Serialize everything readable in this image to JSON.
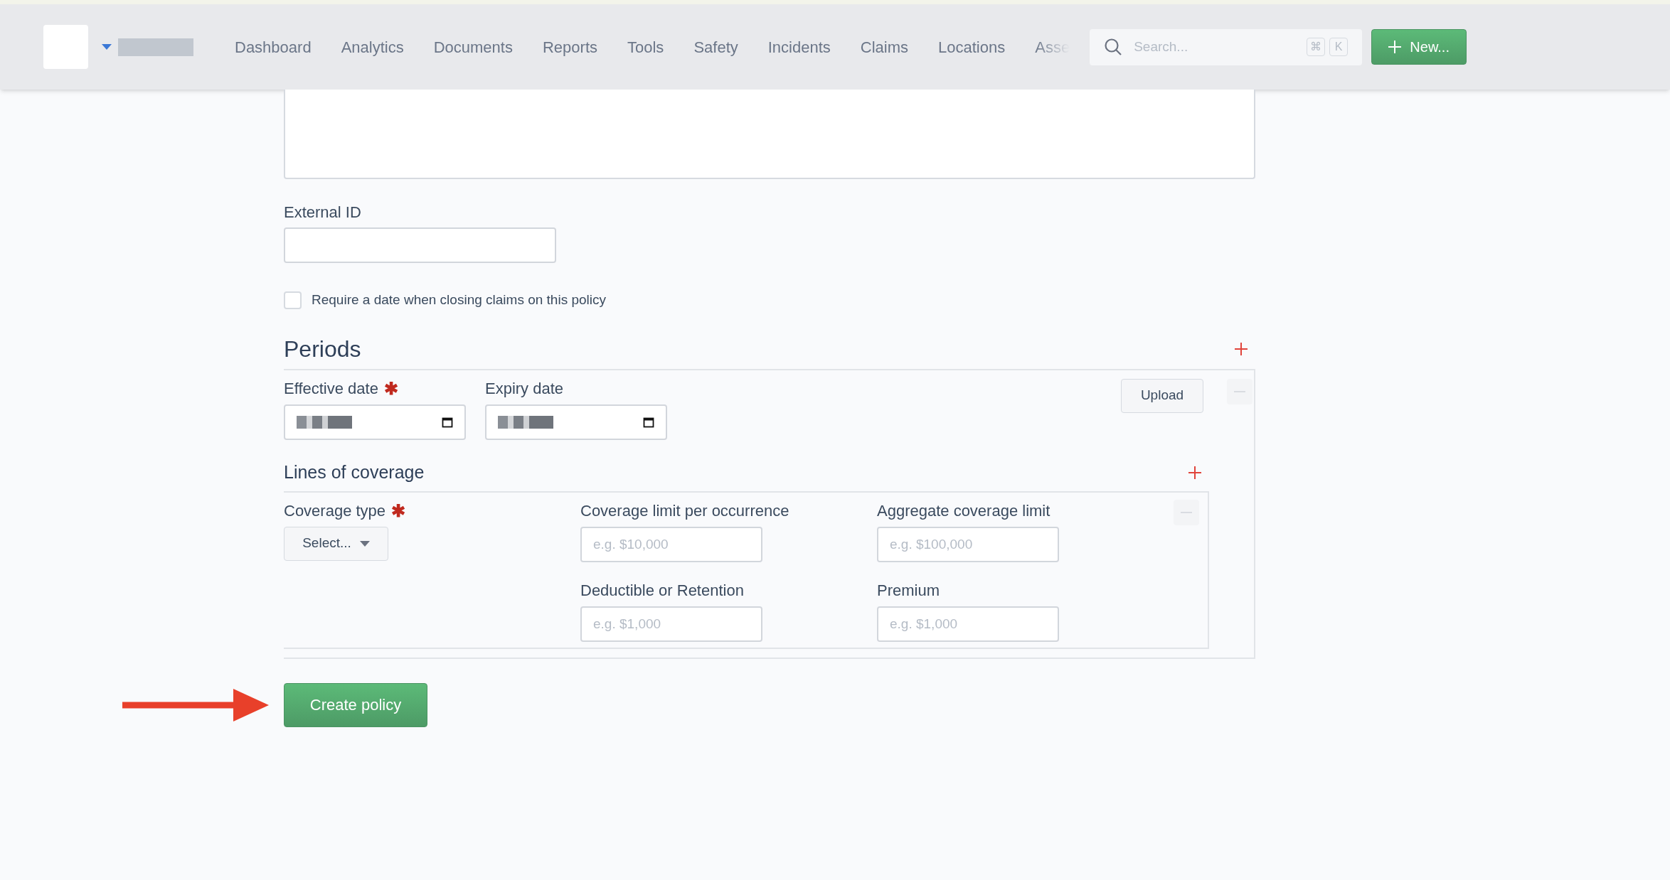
{
  "nav": {
    "items": [
      {
        "label": "Dashboard",
        "faded": false
      },
      {
        "label": "Analytics",
        "faded": false
      },
      {
        "label": "Documents",
        "faded": false
      },
      {
        "label": "Reports",
        "faded": false
      },
      {
        "label": "Tools",
        "faded": false
      },
      {
        "label": "Safety",
        "faded": false
      },
      {
        "label": "Incidents",
        "faded": false
      },
      {
        "label": "Claims",
        "faded": false
      },
      {
        "label": "Locations",
        "faded": false
      },
      {
        "label": "Asse",
        "faded": true
      }
    ],
    "search": {
      "placeholder": "Search...",
      "keys": [
        "⌘",
        "K"
      ]
    },
    "new_button": "New..."
  },
  "form": {
    "external_id": {
      "label": "External ID"
    },
    "require_date": {
      "label": "Require a date when closing claims on this policy",
      "checked": false
    },
    "periods": {
      "title": "Periods",
      "upload": "Upload",
      "dates": [
        {
          "label": "Effective date",
          "required_mark": "✱"
        },
        {
          "label": "Expiry date"
        }
      ],
      "lines_of_coverage": {
        "title": "Lines of coverage",
        "coverage_type": {
          "label": "Coverage type",
          "required_mark": "✱",
          "value": "Select..."
        },
        "fields": [
          {
            "label": "Coverage limit per occurrence",
            "placeholder": "e.g. $10,000"
          },
          {
            "label": "Aggregate coverage limit",
            "placeholder": "e.g. $100,000"
          },
          {
            "label": "Deductible or Retention",
            "placeholder": "e.g. $1,000"
          },
          {
            "label": "Premium",
            "placeholder": "e.g. $1,000"
          }
        ]
      }
    },
    "submit": "Create policy"
  }
}
